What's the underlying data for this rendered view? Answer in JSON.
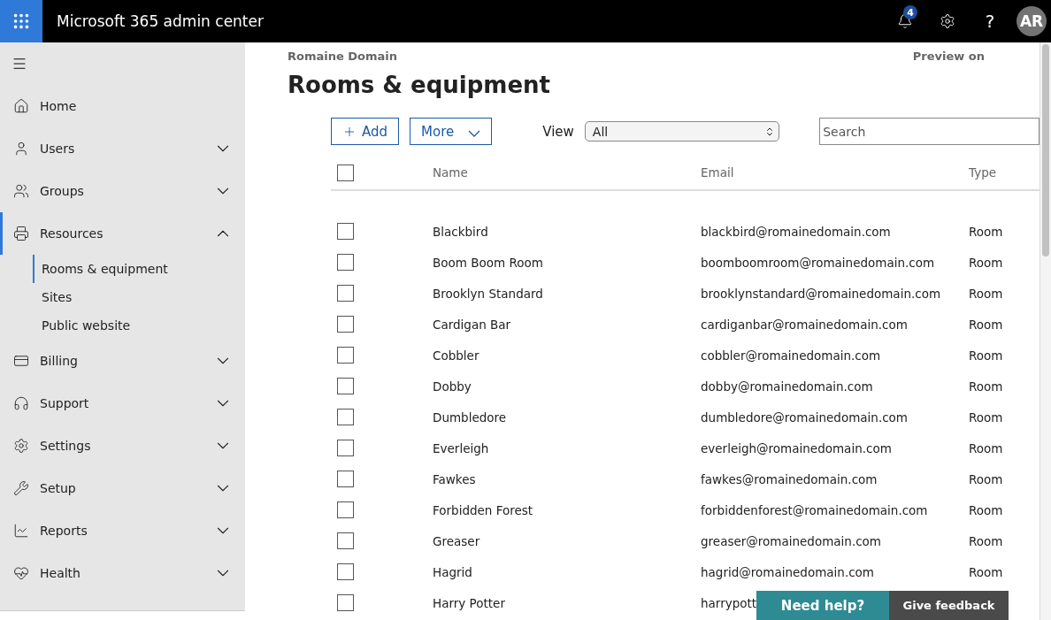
{
  "header": {
    "title": "Microsoft 365 admin center",
    "notification_count": "4",
    "help_label": "?",
    "avatar_initials": "AR"
  },
  "sidebar": {
    "items": [
      {
        "label": "Home",
        "selected": false
      },
      {
        "label": "Users",
        "selected": false,
        "expanded": false
      },
      {
        "label": "Groups",
        "selected": false,
        "expanded": false
      },
      {
        "label": "Resources",
        "selected": true,
        "expanded": true,
        "children": [
          {
            "label": "Rooms & equipment",
            "selected": true
          },
          {
            "label": "Sites",
            "selected": false
          },
          {
            "label": "Public website",
            "selected": false
          }
        ]
      },
      {
        "label": "Billing",
        "selected": false,
        "expanded": false
      },
      {
        "label": "Support",
        "selected": false,
        "expanded": false
      },
      {
        "label": "Settings",
        "selected": false,
        "expanded": false
      },
      {
        "label": "Setup",
        "selected": false,
        "expanded": false
      },
      {
        "label": "Reports",
        "selected": false,
        "expanded": false
      },
      {
        "label": "Health",
        "selected": false,
        "expanded": false
      }
    ]
  },
  "breadcrumb": "Romaine Domain",
  "preview": "Preview on",
  "page_title": "Rooms & equipment",
  "toolbar": {
    "add_label": "Add",
    "more_label": "More",
    "view_label": "View",
    "view_value": "All",
    "search_placeholder": "Search"
  },
  "table": {
    "select_all_checked": false,
    "columns": [
      "Name",
      "Email",
      "Type"
    ],
    "rows": [
      {
        "checked": false,
        "name": "Blackbird",
        "email": "blackbird@romainedomain.com",
        "type": "Room"
      },
      {
        "checked": false,
        "name": "Boom Boom Room",
        "email": "boomboomroom@romainedomain.com",
        "type": "Room"
      },
      {
        "checked": false,
        "name": "Brooklyn Standard",
        "email": "brooklynstandard@romainedomain.com",
        "type": "Room"
      },
      {
        "checked": false,
        "name": "Cardigan Bar",
        "email": "cardiganbar@romainedomain.com",
        "type": "Room"
      },
      {
        "checked": false,
        "name": "Cobbler",
        "email": "cobbler@romainedomain.com",
        "type": "Room"
      },
      {
        "checked": false,
        "name": "Dobby",
        "email": "dobby@romainedomain.com",
        "type": "Room"
      },
      {
        "checked": false,
        "name": "Dumbledore",
        "email": "dumbledore@romainedomain.com",
        "type": "Room"
      },
      {
        "checked": false,
        "name": "Everleigh",
        "email": "everleigh@romainedomain.com",
        "type": "Room"
      },
      {
        "checked": false,
        "name": "Fawkes",
        "email": "fawkes@romainedomain.com",
        "type": "Room"
      },
      {
        "checked": false,
        "name": "Forbidden Forest",
        "email": "forbiddenforest@romainedomain.com",
        "type": "Room"
      },
      {
        "checked": false,
        "name": "Greaser",
        "email": "greaser@romainedomain.com",
        "type": "Room"
      },
      {
        "checked": false,
        "name": "Hagrid",
        "email": "hagrid@romainedomain.com",
        "type": "Room"
      },
      {
        "checked": false,
        "name": "Harry Potter",
        "email": "harrypott"
      }
    ]
  },
  "footer_buttons": {
    "help": "Need help?",
    "feedback": "Give feedback"
  }
}
